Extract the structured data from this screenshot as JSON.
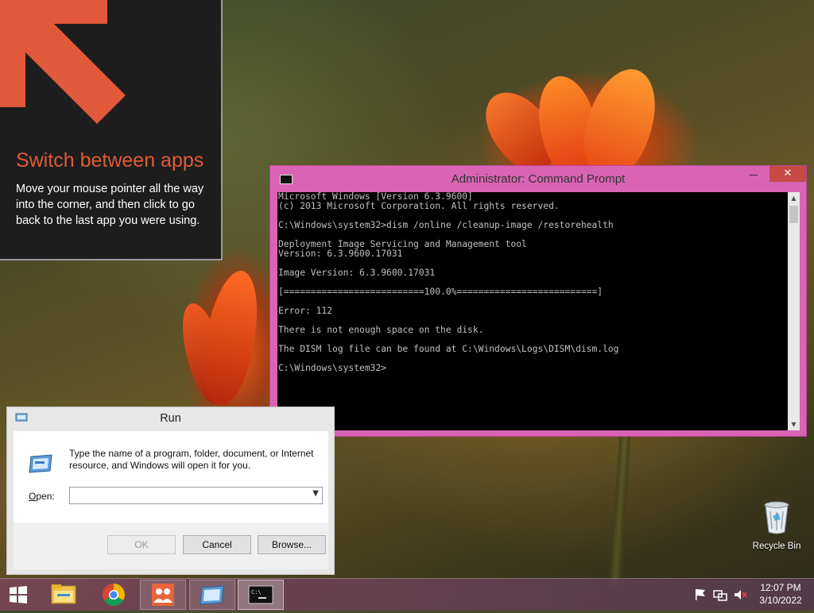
{
  "tip": {
    "title": "Switch between apps",
    "body": "Move your mouse pointer all the way into the corner, and then click to go back to the last app you were using.",
    "accent_color": "#e05a36",
    "arrow_color": "#e2583a"
  },
  "cmd_window": {
    "title": "Administrator: Command Prompt",
    "minimize_glyph": "—",
    "maximize_glyph": "☐",
    "close_glyph": "✕",
    "lines": [
      "Microsoft Windows [Version 6.3.9600]",
      "(c) 2013 Microsoft Corporation. All rights reserved.",
      "",
      "C:\\Windows\\system32>dism /online /cleanup-image /restorehealth",
      "",
      "Deployment Image Servicing and Management tool",
      "Version: 6.3.9600.17031",
      "",
      "Image Version: 6.3.9600.17031",
      "",
      "[==========================100.0%==========================]",
      "",
      "Error: 112",
      "",
      "There is not enough space on the disk.",
      "",
      "The DISM log file can be found at C:\\Windows\\Logs\\DISM\\dism.log",
      "",
      "C:\\Windows\\system32>"
    ],
    "frame_color": "#d964b4"
  },
  "run_dialog": {
    "title": "Run",
    "description": "Type the name of a program, folder, document, or Internet resource, and Windows will open it for you.",
    "open_label_underlined": "O",
    "open_label_rest": "pen:",
    "open_value": "",
    "ok_label": "OK",
    "cancel_label": "Cancel",
    "browse_label": "Browse..."
  },
  "desktop": {
    "recycle_bin_label": "Recycle Bin"
  },
  "taskbar": {
    "items": [
      "start-button",
      "file-explorer",
      "chrome",
      "people",
      "run",
      "command-prompt"
    ],
    "clock_time": "12:07 PM",
    "clock_date": "3/10/2022"
  }
}
